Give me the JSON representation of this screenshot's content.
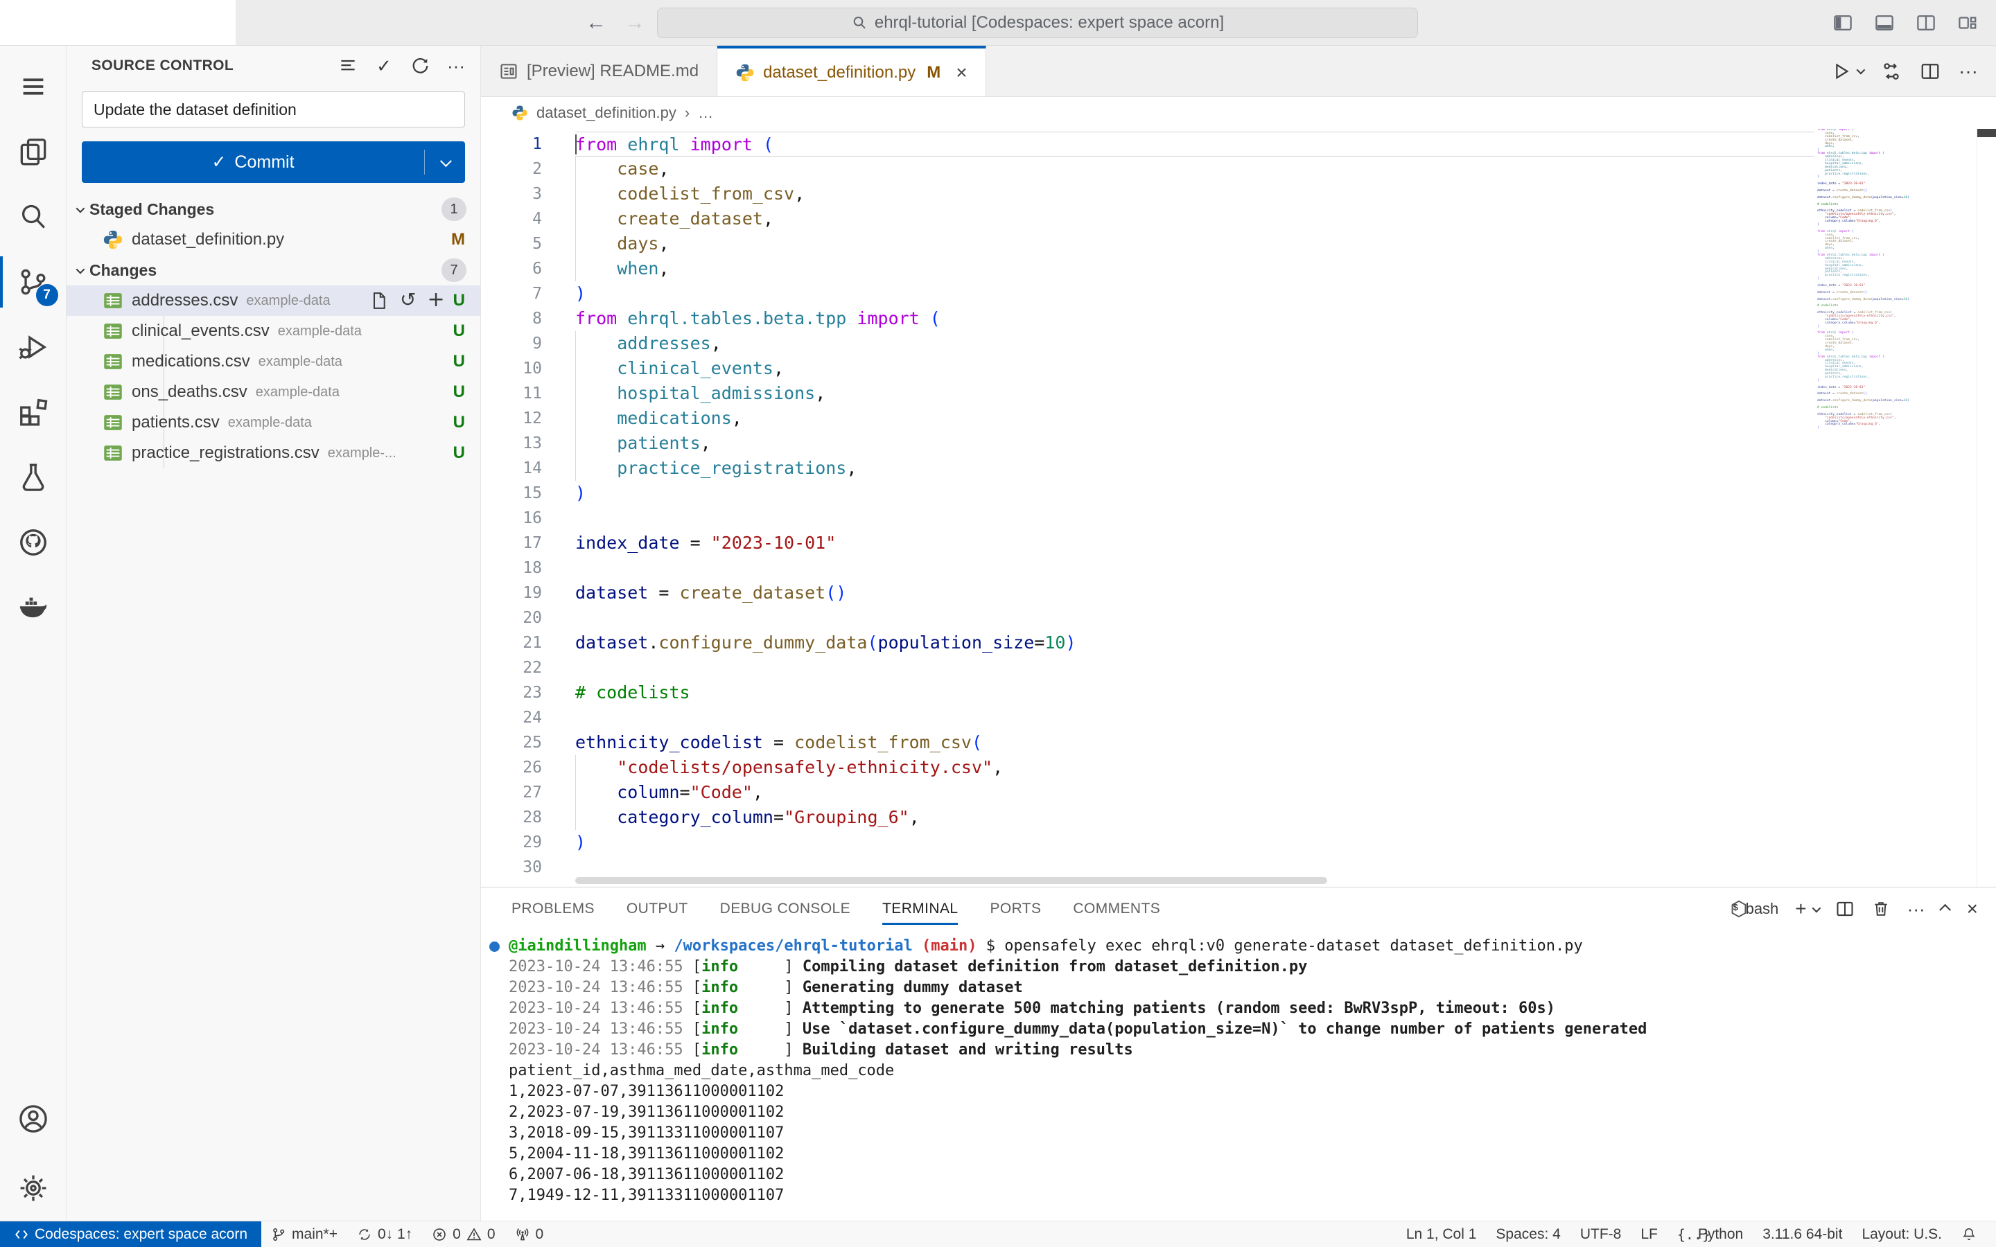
{
  "titlebar": {
    "search_text": "ehrql-tutorial [Codespaces: expert space acorn]"
  },
  "activity_bar": {
    "items": [
      {
        "icon": "menu"
      },
      {
        "icon": "explorer"
      },
      {
        "icon": "search"
      },
      {
        "icon": "source-control",
        "active": true,
        "badge": "7"
      },
      {
        "icon": "run-debug"
      },
      {
        "icon": "extensions"
      },
      {
        "icon": "testing"
      },
      {
        "icon": "github"
      },
      {
        "icon": "docker"
      }
    ],
    "bottom_items": [
      {
        "icon": "account"
      },
      {
        "icon": "settings"
      }
    ]
  },
  "source_control": {
    "title": "SOURCE CONTROL",
    "message": "Update the dataset definition",
    "commit_label": "Commit",
    "groups": [
      {
        "label": "Staged Changes",
        "count": "1",
        "files": [
          {
            "name": "dataset_definition.py",
            "desc": "",
            "status": "M",
            "icon": "python",
            "selected": false,
            "actions": false
          }
        ]
      },
      {
        "label": "Changes",
        "count": "7",
        "files": [
          {
            "name": "addresses.csv",
            "desc": "example-data",
            "status": "U",
            "icon": "csv",
            "selected": true,
            "actions": true
          },
          {
            "name": "clinical_events.csv",
            "desc": "example-data",
            "status": "U",
            "icon": "csv"
          },
          {
            "name": "medications.csv",
            "desc": "example-data",
            "status": "U",
            "icon": "csv"
          },
          {
            "name": "ons_deaths.csv",
            "desc": "example-data",
            "status": "U",
            "icon": "csv"
          },
          {
            "name": "patients.csv",
            "desc": "example-data",
            "status": "U",
            "icon": "csv"
          },
          {
            "name": "practice_registrations.csv",
            "desc": "example-...",
            "status": "U",
            "icon": "csv"
          }
        ]
      }
    ]
  },
  "editor": {
    "tabs": [
      {
        "label": "[Preview] README.md",
        "icon": "preview",
        "active": false
      },
      {
        "label": "dataset_definition.py",
        "icon": "python",
        "active": true,
        "dirty": "M"
      }
    ],
    "breadcrumb": {
      "file": "dataset_definition.py",
      "more": "…"
    },
    "code_lines": [
      {
        "n": 1,
        "cur": true,
        "tokens": [
          [
            "k",
            "from"
          ],
          [
            "p",
            " "
          ],
          [
            "t",
            "ehrql"
          ],
          [
            "p",
            " "
          ],
          [
            "k",
            "import"
          ],
          [
            "p",
            " "
          ],
          [
            "b",
            "("
          ]
        ]
      },
      {
        "n": 2,
        "g": true,
        "tokens": [
          [
            "p",
            "    "
          ],
          [
            "f",
            "case"
          ],
          [
            "p",
            ","
          ]
        ]
      },
      {
        "n": 3,
        "g": true,
        "tokens": [
          [
            "p",
            "    "
          ],
          [
            "f",
            "codelist_from_csv"
          ],
          [
            "p",
            ","
          ]
        ]
      },
      {
        "n": 4,
        "g": true,
        "tokens": [
          [
            "p",
            "    "
          ],
          [
            "f",
            "create_dataset"
          ],
          [
            "p",
            ","
          ]
        ]
      },
      {
        "n": 5,
        "g": true,
        "tokens": [
          [
            "p",
            "    "
          ],
          [
            "f",
            "days"
          ],
          [
            "p",
            ","
          ]
        ]
      },
      {
        "n": 6,
        "g": true,
        "tokens": [
          [
            "p",
            "    "
          ],
          [
            "t",
            "when"
          ],
          [
            "p",
            ","
          ]
        ]
      },
      {
        "n": 7,
        "tokens": [
          [
            "b",
            ")"
          ]
        ]
      },
      {
        "n": 8,
        "tokens": [
          [
            "k",
            "from"
          ],
          [
            "p",
            " "
          ],
          [
            "t",
            "ehrql.tables.beta.tpp"
          ],
          [
            "p",
            " "
          ],
          [
            "k",
            "import"
          ],
          [
            "p",
            " "
          ],
          [
            "b",
            "("
          ]
        ]
      },
      {
        "n": 9,
        "g": true,
        "tokens": [
          [
            "p",
            "    "
          ],
          [
            "t",
            "addresses"
          ],
          [
            "p",
            ","
          ]
        ]
      },
      {
        "n": 10,
        "g": true,
        "tokens": [
          [
            "p",
            "    "
          ],
          [
            "t",
            "clinical_events"
          ],
          [
            "p",
            ","
          ]
        ]
      },
      {
        "n": 11,
        "g": true,
        "tokens": [
          [
            "p",
            "    "
          ],
          [
            "t",
            "hospital_admissions"
          ],
          [
            "p",
            ","
          ]
        ]
      },
      {
        "n": 12,
        "g": true,
        "tokens": [
          [
            "p",
            "    "
          ],
          [
            "t",
            "medications"
          ],
          [
            "p",
            ","
          ]
        ]
      },
      {
        "n": 13,
        "g": true,
        "tokens": [
          [
            "p",
            "    "
          ],
          [
            "t",
            "patients"
          ],
          [
            "p",
            ","
          ]
        ]
      },
      {
        "n": 14,
        "g": true,
        "tokens": [
          [
            "p",
            "    "
          ],
          [
            "t",
            "practice_registrations"
          ],
          [
            "p",
            ","
          ]
        ]
      },
      {
        "n": 15,
        "tokens": [
          [
            "b",
            ")"
          ]
        ]
      },
      {
        "n": 16,
        "tokens": []
      },
      {
        "n": 17,
        "tokens": [
          [
            "v",
            "index_date"
          ],
          [
            "p",
            " = "
          ],
          [
            "s",
            "\"2023-10-01\""
          ]
        ]
      },
      {
        "n": 18,
        "tokens": []
      },
      {
        "n": 19,
        "tokens": [
          [
            "v",
            "dataset"
          ],
          [
            "p",
            " = "
          ],
          [
            "f",
            "create_dataset"
          ],
          [
            "b",
            "()"
          ]
        ]
      },
      {
        "n": 20,
        "tokens": []
      },
      {
        "n": 21,
        "tokens": [
          [
            "v",
            "dataset"
          ],
          [
            "p",
            "."
          ],
          [
            "f",
            "configure_dummy_data"
          ],
          [
            "b",
            "("
          ],
          [
            "v",
            "population_size"
          ],
          [
            "p",
            "="
          ],
          [
            "n",
            "10"
          ],
          [
            "b",
            ")"
          ]
        ]
      },
      {
        "n": 22,
        "tokens": []
      },
      {
        "n": 23,
        "tokens": [
          [
            "c",
            "# codelists"
          ]
        ]
      },
      {
        "n": 24,
        "tokens": []
      },
      {
        "n": 25,
        "tokens": [
          [
            "v",
            "ethnicity_codelist"
          ],
          [
            "p",
            " = "
          ],
          [
            "f",
            "codelist_from_csv"
          ],
          [
            "b",
            "("
          ]
        ]
      },
      {
        "n": 26,
        "g": true,
        "tokens": [
          [
            "p",
            "    "
          ],
          [
            "s",
            "\"codelists/opensafely-ethnicity.csv\""
          ],
          [
            "p",
            ","
          ]
        ]
      },
      {
        "n": 27,
        "g": true,
        "tokens": [
          [
            "p",
            "    "
          ],
          [
            "v",
            "column"
          ],
          [
            "p",
            "="
          ],
          [
            "s",
            "\"Code\""
          ],
          [
            "p",
            ","
          ]
        ]
      },
      {
        "n": 28,
        "g": true,
        "tokens": [
          [
            "p",
            "    "
          ],
          [
            "v",
            "category_column"
          ],
          [
            "p",
            "="
          ],
          [
            "s",
            "\"Grouping_6\""
          ],
          [
            "p",
            ","
          ]
        ]
      },
      {
        "n": 29,
        "tokens": [
          [
            "b",
            ")"
          ]
        ]
      },
      {
        "n": 30,
        "tokens": []
      }
    ]
  },
  "panel": {
    "tabs": [
      {
        "label": "PROBLEMS"
      },
      {
        "label": "OUTPUT"
      },
      {
        "label": "DEBUG CONSOLE"
      },
      {
        "label": "TERMINAL",
        "active": true
      },
      {
        "label": "PORTS"
      },
      {
        "label": "COMMENTS"
      }
    ],
    "shell": "bash"
  },
  "terminal": {
    "lines": [
      {
        "type": "prompt",
        "user": "@iaindillingham",
        "arrow": " → ",
        "path": "/workspaces/ehrql-tutorial",
        "branch": " (main)",
        "cmd": " $ opensafely exec ehrql:v0 generate-dataset dataset_definition.py"
      },
      {
        "type": "log",
        "ts": "2023-10-24 13:46:55 ",
        "level": "info",
        "msg": "Compiling dataset definition from dataset_definition.py"
      },
      {
        "type": "log",
        "ts": "2023-10-24 13:46:55 ",
        "level": "info",
        "msg": "Generating dummy dataset"
      },
      {
        "type": "log",
        "ts": "2023-10-24 13:46:55 ",
        "level": "info",
        "msg": "Attempting to generate 500 matching patients (random seed: BwRV3spP, timeout: 60s)"
      },
      {
        "type": "log",
        "ts": "2023-10-24 13:46:55 ",
        "level": "info",
        "msg": "Use `dataset.configure_dummy_data(population_size=N)` to change number of patients generated"
      },
      {
        "type": "log",
        "ts": "2023-10-24 13:46:55 ",
        "level": "info",
        "msg": "Building dataset and writing results"
      },
      {
        "type": "plain",
        "text": "patient_id,asthma_med_date,asthma_med_code"
      },
      {
        "type": "plain",
        "text": "1,2023-07-07,39113611000001102"
      },
      {
        "type": "plain",
        "text": "2,2023-07-19,39113611000001102"
      },
      {
        "type": "plain",
        "text": "3,2018-09-15,39113311000001107"
      },
      {
        "type": "plain",
        "text": "5,2004-11-18,39113611000001102"
      },
      {
        "type": "plain",
        "text": "6,2007-06-18,39113611000001102"
      },
      {
        "type": "plain",
        "text": "7,1949-12-11,39113311000001107"
      }
    ]
  },
  "statusbar": {
    "left": [
      {
        "name": "remote-indicator",
        "accent": true,
        "parts": [
          {
            "icon": "remote"
          },
          {
            "text": "Codespaces: expert space acorn"
          }
        ]
      },
      {
        "name": "git-branch",
        "parts": [
          {
            "icon": "branch"
          },
          {
            "text": "main*+"
          }
        ]
      },
      {
        "name": "sync-changes",
        "parts": [
          {
            "icon": "sync"
          },
          {
            "text": "0↓ 1↑"
          }
        ]
      },
      {
        "name": "problems",
        "parts": [
          {
            "icon": "error"
          },
          {
            "text": "0"
          },
          {
            "icon": "warning"
          },
          {
            "text": "0"
          }
        ]
      },
      {
        "name": "forwarded-ports",
        "parts": [
          {
            "icon": "radio-tower"
          },
          {
            "text": "0"
          }
        ]
      }
    ],
    "right": [
      {
        "name": "cursor-position",
        "parts": [
          {
            "text": "Ln 1, Col 1"
          }
        ]
      },
      {
        "name": "indentation",
        "parts": [
          {
            "text": "Spaces: 4"
          }
        ]
      },
      {
        "name": "encoding",
        "parts": [
          {
            "text": "UTF-8"
          }
        ]
      },
      {
        "name": "eol",
        "parts": [
          {
            "text": "LF"
          }
        ]
      },
      {
        "name": "language-mode",
        "parts": [
          {
            "icon": "braces"
          },
          {
            "text": "Python"
          }
        ]
      },
      {
        "name": "python-version",
        "parts": [
          {
            "text": "3.11.6 64-bit"
          }
        ]
      },
      {
        "name": "keyboard-layout",
        "parts": [
          {
            "text": "Layout: U.S."
          }
        ]
      },
      {
        "name": "notifications",
        "parts": [
          {
            "icon": "bell"
          }
        ]
      }
    ]
  },
  "colors": {
    "accent": "#005FB8",
    "modified": "#895503",
    "untracked": "#107c10",
    "keyword": "#AF00DB",
    "type": "#267F99",
    "function": "#795E26",
    "variable": "#001080",
    "string": "#A31515",
    "number": "#098658",
    "comment": "#008000"
  }
}
